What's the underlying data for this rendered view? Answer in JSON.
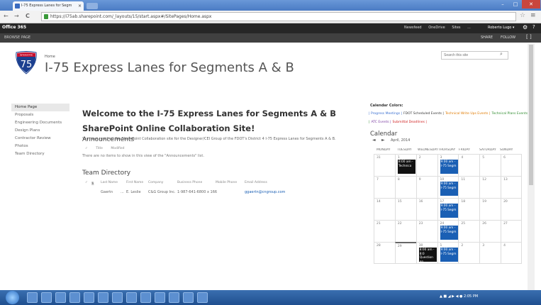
{
  "browser": {
    "tab_title": "I-75 Express Lanes for Segm",
    "tab_close": "×",
    "url": "https://i75ab.sharepoint.com/_layouts/15/start.aspx#/SitePages/Home.aspx",
    "back": "←",
    "forward": "→",
    "reload": "C",
    "star": "☆",
    "menu": "≡",
    "win_min": "–",
    "win_max": "□",
    "win_close": "✕"
  },
  "suite": {
    "brand": "Office 365",
    "links": [
      "Newsfeed",
      "OneDrive",
      "Sites",
      "..."
    ],
    "user": "Roberto Lugo ▾",
    "gear": "⚙",
    "help": "?"
  },
  "ribbon": {
    "browse": "BROWSE",
    "page": "PAGE",
    "share": "SHARE",
    "follow": "FOLLOW",
    "focus": "[ ]"
  },
  "header": {
    "shield_text": "75",
    "shield_top": "INTERSTATE",
    "home_link": "Home",
    "site_title": "I-75 Express Lanes for Segments A & B",
    "search_placeholder": "Search this site",
    "search_icon": "⌕"
  },
  "leftnav": {
    "items": [
      "Home Page",
      "Proposals",
      "Engineering Documents",
      "Design Plans",
      "Contractor Review",
      "Photos",
      "Team Directory"
    ]
  },
  "main": {
    "welcome_title": "Welcome to the I-75 Express Lanes for Segments A & B SharePoint Online Collaboration Site!",
    "welcome_text": "You have reached the SharePoint Collaboration site for the Designer/CEI Group of the FDOT's District 4 I-75 Express Lanes for Segments A & B.",
    "announcements": {
      "title": "Announcements",
      "cols": [
        "✓",
        "Title",
        "Modified"
      ],
      "empty": "There are no items to show in this view of the \"Announcements\" list."
    },
    "team": {
      "title": "Team Directory",
      "head": [
        "✓",
        "🗎",
        "Last Name",
        "First Name",
        "Company",
        "Business Phone",
        "Mobile Phone",
        "Email Address"
      ],
      "row": [
        "Gaertn",
        "...",
        "E. Leslie",
        "C&G Group Inc.",
        "1-987-641-6800 x 166",
        "",
        "ggaertn@cngroup.com"
      ]
    }
  },
  "calendar": {
    "colors_label": "Calendar Colors:",
    "legend": [
      {
        "text": "| Progress Meetings |",
        "color": "#3a6fd0"
      },
      {
        "text": "FDOT Scheduled Events |",
        "color": "#333333"
      },
      {
        "text": "Technical Write Ups Events |",
        "color": "#e07a00"
      },
      {
        "text": "Technical Plans Events |",
        "color": "#2e8b2e"
      },
      {
        "text": "ATC Events |",
        "color": "#7a3aa0"
      },
      {
        "text": "Submittal Deadlines |",
        "color": "#d02020"
      }
    ],
    "title": "Calendar",
    "prev": "◄",
    "next": "►",
    "month": "April, 2014",
    "days": [
      "MONDAY",
      "TUESDAY",
      "WEDNESDAY",
      "THURSDAY",
      "FRIDAY",
      "SATURDAY",
      "SUNDAY"
    ],
    "weeks": [
      [
        "31",
        "1",
        "2",
        "3",
        "4",
        "5",
        "6"
      ],
      [
        "7",
        "8",
        "9",
        "10",
        "11",
        "12",
        "13"
      ],
      [
        "14",
        "15",
        "16",
        "17",
        "18",
        "19",
        "20"
      ],
      [
        "21",
        "22",
        "23",
        "24",
        "25",
        "26",
        "27"
      ],
      [
        "28",
        "29",
        "30",
        "1",
        "2",
        "3",
        "4"
      ]
    ],
    "events": {
      "w0d1": "8:00 am - Technica",
      "w0d3": "9:00 am - I-75 Segm",
      "w1d3": "9:00 am - I-75 Segm",
      "w2d3": "9:00 am - I-75 Segm",
      "w3d3": "9:00 am - I-75 Segm",
      "w4d2": "8:00 am - 8:0 Question an",
      "w4d3": "9:00 am - I-75 Segm"
    }
  },
  "taskbar": {
    "tray": "▲ ■ ◢ ▶ ◀ ●  2:05 PM"
  }
}
